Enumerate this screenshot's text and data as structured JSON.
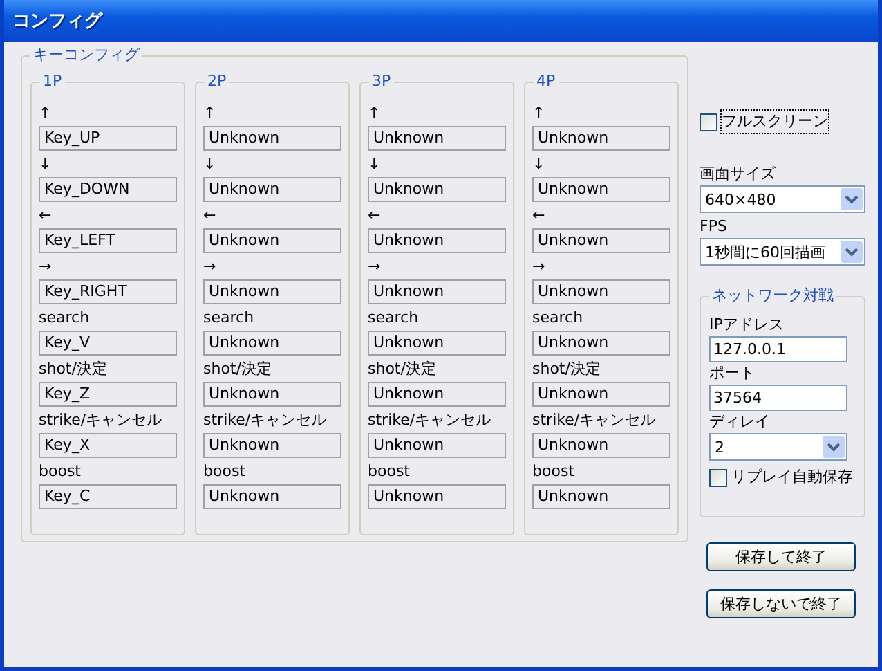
{
  "window": {
    "title": "コンフィグ"
  },
  "key_config": {
    "title": "キーコンフィグ",
    "players": [
      {
        "name": "1P",
        "bindings": [
          {
            "label": "↑",
            "value": "Key_UP"
          },
          {
            "label": "↓",
            "value": "Key_DOWN"
          },
          {
            "label": "←",
            "value": "Key_LEFT"
          },
          {
            "label": "→",
            "value": "Key_RIGHT"
          },
          {
            "label": "search",
            "value": "Key_V"
          },
          {
            "label": "shot/決定",
            "value": "Key_Z"
          },
          {
            "label": "strike/キャンセル",
            "value": "Key_X"
          },
          {
            "label": "boost",
            "value": "Key_C"
          }
        ]
      },
      {
        "name": "2P",
        "bindings": [
          {
            "label": "↑",
            "value": "Unknown"
          },
          {
            "label": "↓",
            "value": "Unknown"
          },
          {
            "label": "←",
            "value": "Unknown"
          },
          {
            "label": "→",
            "value": "Unknown"
          },
          {
            "label": "search",
            "value": "Unknown"
          },
          {
            "label": "shot/決定",
            "value": "Unknown"
          },
          {
            "label": "strike/キャンセル",
            "value": "Unknown"
          },
          {
            "label": "boost",
            "value": "Unknown"
          }
        ]
      },
      {
        "name": "3P",
        "bindings": [
          {
            "label": "↑",
            "value": "Unknown"
          },
          {
            "label": "↓",
            "value": "Unknown"
          },
          {
            "label": "←",
            "value": "Unknown"
          },
          {
            "label": "→",
            "value": "Unknown"
          },
          {
            "label": "search",
            "value": "Unknown"
          },
          {
            "label": "shot/決定",
            "value": "Unknown"
          },
          {
            "label": "strike/キャンセル",
            "value": "Unknown"
          },
          {
            "label": "boost",
            "value": "Unknown"
          }
        ]
      },
      {
        "name": "4P",
        "bindings": [
          {
            "label": "↑",
            "value": "Unknown"
          },
          {
            "label": "↓",
            "value": "Unknown"
          },
          {
            "label": "←",
            "value": "Unknown"
          },
          {
            "label": "→",
            "value": "Unknown"
          },
          {
            "label": "search",
            "value": "Unknown"
          },
          {
            "label": "shot/決定",
            "value": "Unknown"
          },
          {
            "label": "strike/キャンセル",
            "value": "Unknown"
          },
          {
            "label": "boost",
            "value": "Unknown"
          }
        ]
      }
    ]
  },
  "fullscreen": {
    "label": "フルスクリーン",
    "checked": false
  },
  "screen_size": {
    "label": "画面サイズ",
    "value": "640×480"
  },
  "fps": {
    "label": "FPS",
    "value": "1秒間に60回描画"
  },
  "network": {
    "title": "ネットワーク対戦",
    "ip": {
      "label": "IPアドレス",
      "value": "127.0.0.1"
    },
    "port": {
      "label": "ポート",
      "value": "37564"
    },
    "delay": {
      "label": "ディレイ",
      "value": "2"
    },
    "auto_save_replay": {
      "label": "リプレイ自動保存",
      "checked": false
    }
  },
  "buttons": [
    "保存して終了",
    "保存しないで終了"
  ]
}
